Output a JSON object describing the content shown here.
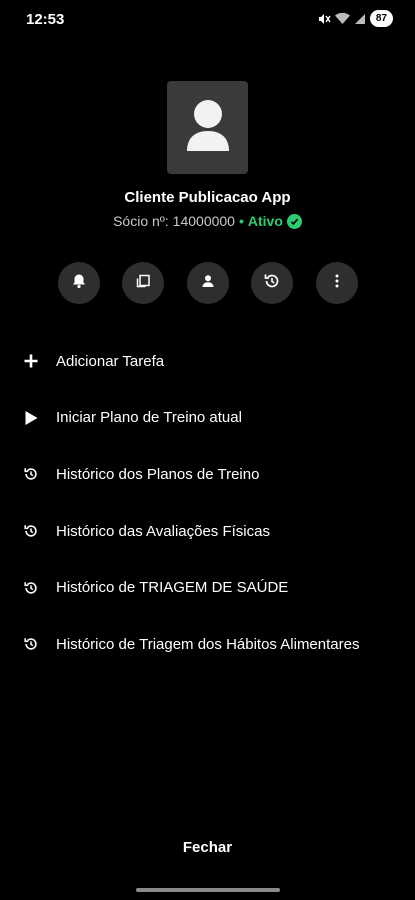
{
  "status_bar": {
    "time": "12:53",
    "battery": "87",
    "icons": [
      "mute-icon",
      "wifi-icon",
      "signal-icon",
      "battery-icon"
    ]
  },
  "profile": {
    "name": "Cliente Publicacao App",
    "member_label": "Sócio nº: 14000000",
    "separator": "•",
    "status": "Ativo",
    "status_color": "#2ecc71",
    "avatar_icon": "person-placeholder-icon"
  },
  "actions": [
    {
      "icon": "bell-icon"
    },
    {
      "icon": "copy-document-icon"
    },
    {
      "icon": "person-icon"
    },
    {
      "icon": "history-icon"
    },
    {
      "icon": "more-vertical-icon"
    }
  ],
  "menu": [
    {
      "icon": "plus-icon",
      "label": "Adicionar Tarefa"
    },
    {
      "icon": "play-icon",
      "label": "Iniciar Plano de Treino atual"
    },
    {
      "icon": "history-icon",
      "label": "Histórico dos Planos de Treino"
    },
    {
      "icon": "history-icon",
      "label": "Histórico das Avaliações Físicas"
    },
    {
      "icon": "history-icon",
      "label": "Histórico de TRIAGEM DE SAÚDE"
    },
    {
      "icon": "history-icon",
      "label": "Histórico de Triagem dos Hábitos Alimentares"
    }
  ],
  "footer": {
    "close_label": "Fechar"
  },
  "colors": {
    "background": "#000000",
    "button_bg": "#2e2e2e",
    "avatar_bg": "#3a3a3a",
    "accent_green": "#2ecc71"
  }
}
